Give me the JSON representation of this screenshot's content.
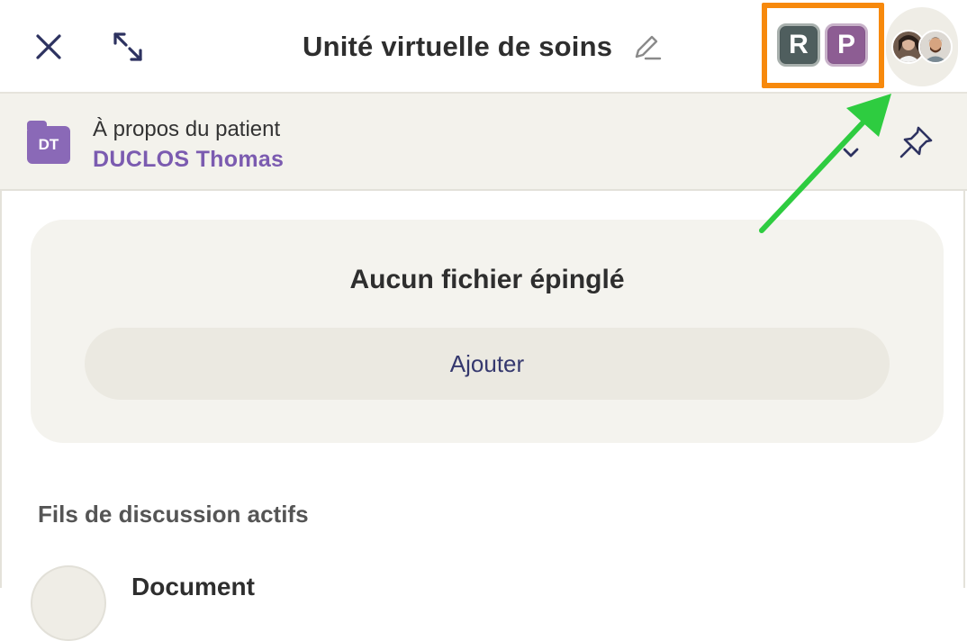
{
  "header": {
    "title": "Unité virtuelle de soins",
    "close_icon": "close-icon",
    "expand_icon": "expand-icon",
    "edit_icon": "pencil-icon",
    "roles": [
      {
        "letter": "R",
        "color": "#4f5e5e"
      },
      {
        "letter": "P",
        "color": "#8d5d93"
      }
    ],
    "highlight_color": "#f7890c"
  },
  "patient": {
    "label": "À propos du patient",
    "initials": "DT",
    "name": "DUCLOS Thomas",
    "accent": "#7b5bb0"
  },
  "pinned": {
    "empty_title": "Aucun fichier épinglé",
    "add_label": "Ajouter"
  },
  "threads": {
    "section_title": "Fils de discussion actifs",
    "items": [
      {
        "title": "Document"
      }
    ]
  },
  "annotation": {
    "arrow_color": "#2ecc40"
  }
}
